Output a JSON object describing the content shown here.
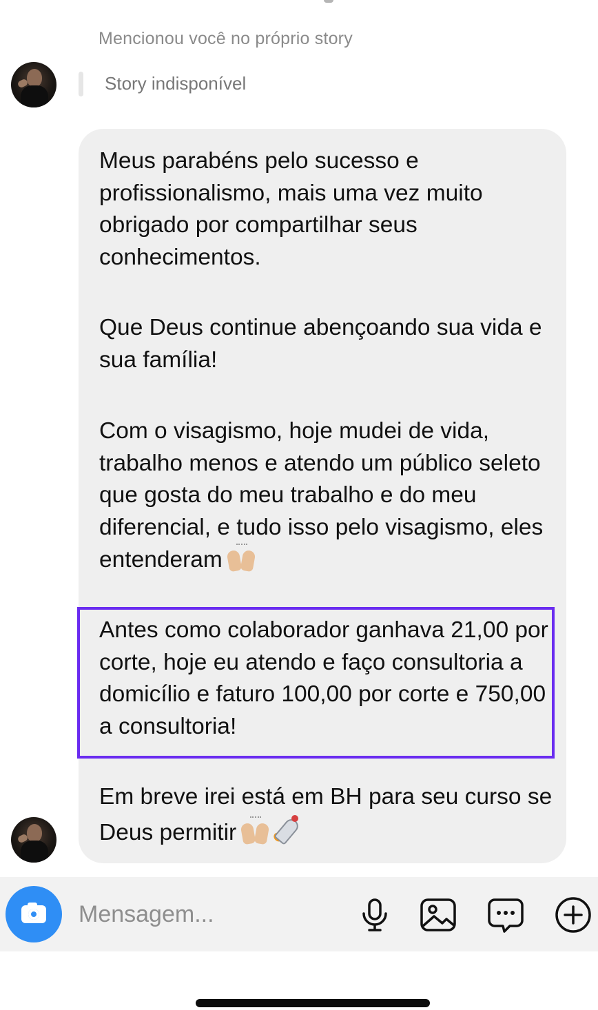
{
  "thread": {
    "mention_note": "Mencionou você no próprio story",
    "story_unavailable": "Story indisponível"
  },
  "message": {
    "paragraph_1": "Meus parabéns pelo sucesso e profissionalismo, mais uma vez muito obrigado por compartilhar seus conhecimentos.",
    "paragraph_2": "Que Deus continue abençoando sua vida e sua família!",
    "paragraph_3": "Com o visagismo, hoje mudei de vida, trabalho menos e atendo um público seleto que gosta do meu trabalho e do meu diferencial, e tudo isso pelo visagismo, eles entenderam",
    "paragraph_4": "Antes como colaborador ganhava 21,00 por corte, hoje eu atendo e faço consultoria a domicílio e faturo 100,00 por corte e 750,00 a consultoria!",
    "paragraph_5": "Em breve irei está em BH para seu curso se Deus permitir",
    "emoji_3": "raising-hands",
    "emoji_5": [
      "raising-hands",
      "rocket"
    ]
  },
  "highlight_color": "#6a2cf0",
  "composer": {
    "placeholder": "Mensagem...",
    "camera_icon": "camera-icon",
    "mic_icon": "microphone-icon",
    "gallery_icon": "image-icon",
    "sticker_icon": "chat-bubble-icon",
    "plus_icon": "plus-circle-icon",
    "accent_color": "#2f8ef5"
  }
}
